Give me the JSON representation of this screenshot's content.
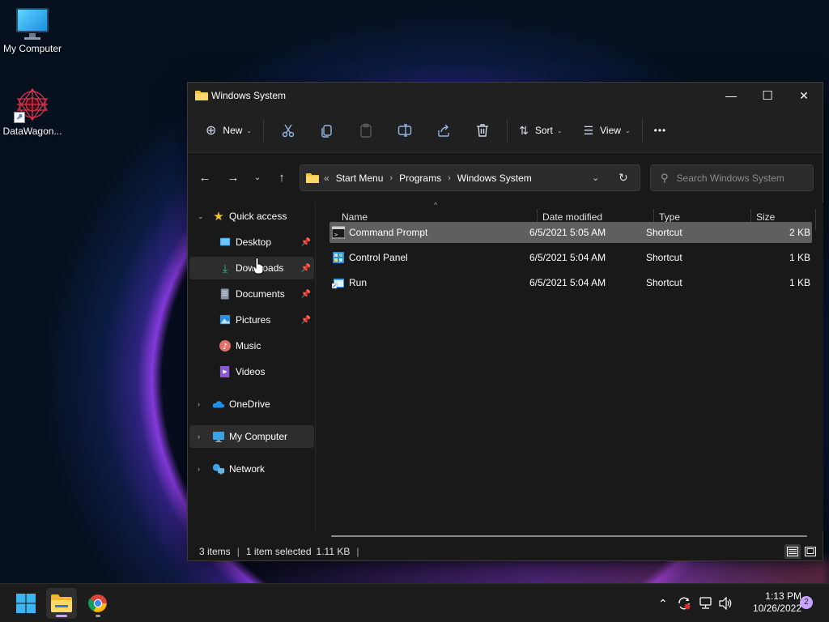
{
  "desktop": {
    "icons": [
      {
        "label": "My Computer"
      },
      {
        "label": "DataWagon..."
      }
    ]
  },
  "window": {
    "title": "Windows System",
    "controls": {
      "minimize": "—",
      "maximize": "☐",
      "close": "✕"
    },
    "commandbar": {
      "new_label": "New",
      "sort_label": "Sort",
      "view_label": "View",
      "more_label": "•••"
    },
    "address": {
      "overflow": "«",
      "crumbs": [
        "Start Menu",
        "Programs",
        "Windows System"
      ]
    },
    "search": {
      "placeholder": "Search Windows System"
    },
    "nav": {
      "quick_access": "Quick access",
      "items": [
        {
          "label": "Desktop"
        },
        {
          "label": "Downloads"
        },
        {
          "label": "Documents"
        },
        {
          "label": "Pictures"
        },
        {
          "label": "Music"
        },
        {
          "label": "Videos"
        }
      ],
      "onedrive": "OneDrive",
      "my_computer": "My Computer",
      "network": "Network"
    },
    "columns": {
      "name": "Name",
      "date": "Date modified",
      "type": "Type",
      "size": "Size"
    },
    "files": [
      {
        "name": "Command Prompt",
        "date": "6/5/2021 5:05 AM",
        "type": "Shortcut",
        "size": "2 KB",
        "selected": true
      },
      {
        "name": "Control Panel",
        "date": "6/5/2021 5:04 AM",
        "type": "Shortcut",
        "size": "1 KB",
        "selected": false
      },
      {
        "name": "Run",
        "date": "6/5/2021 5:04 AM",
        "type": "Shortcut",
        "size": "1 KB",
        "selected": false
      }
    ],
    "status": {
      "items": "3 items",
      "selected": "1 item selected",
      "size": "1.11 KB",
      "divider": "|"
    }
  },
  "taskbar": {
    "time": "1:13 PM",
    "date": "10/26/2022",
    "notifications": "2"
  },
  "colors": {
    "accent_folder": "#f4c542",
    "window_bg": "#191919",
    "selection": "#5f5f5f"
  }
}
